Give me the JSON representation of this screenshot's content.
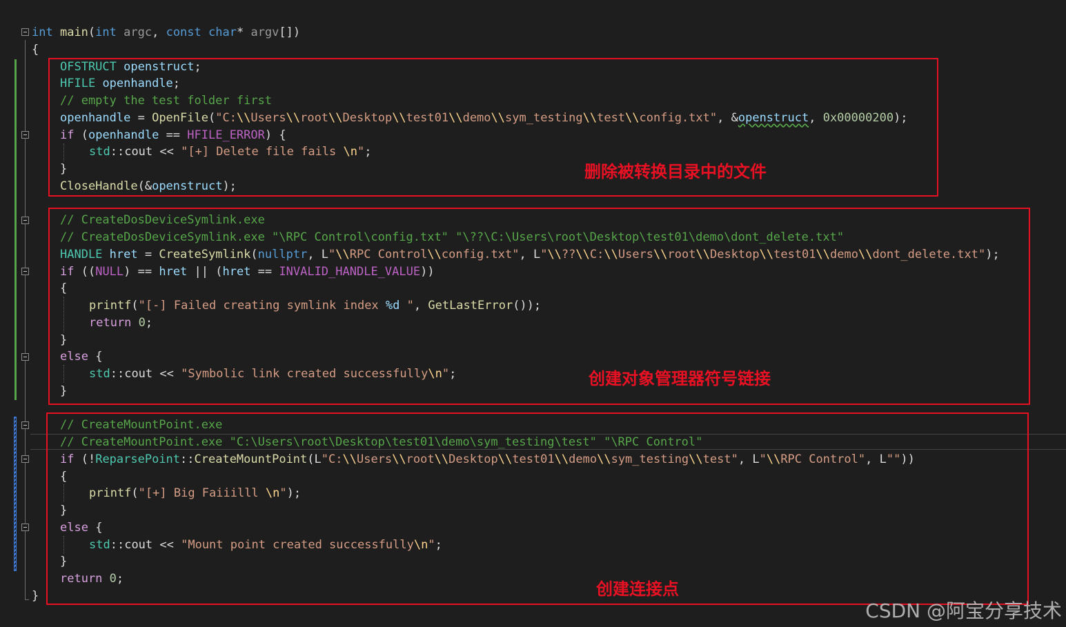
{
  "code_lines": [
    {
      "indent": 0,
      "tokens": [
        {
          "t": "int",
          "c": "#569cd6"
        },
        {
          "t": " "
        },
        {
          "t": "main",
          "c": "#dcdcaa"
        },
        {
          "t": "("
        },
        {
          "t": "int",
          "c": "#569cd6"
        },
        {
          "t": " "
        },
        {
          "t": "argc",
          "c": "#9a9a9a"
        },
        {
          "t": ", "
        },
        {
          "t": "const",
          "c": "#569cd6"
        },
        {
          "t": " "
        },
        {
          "t": "char",
          "c": "#569cd6"
        },
        {
          "t": "* "
        },
        {
          "t": "argv",
          "c": "#9a9a9a"
        },
        {
          "t": "[])"
        }
      ]
    },
    {
      "indent": 0,
      "tokens": [
        {
          "t": "{"
        }
      ]
    },
    {
      "indent": 1,
      "tokens": [
        {
          "t": "OFSTRUCT",
          "c": "#4ec9b0"
        },
        {
          "t": " "
        },
        {
          "t": "openstruct",
          "c": "#9cdcfe"
        },
        {
          "t": ";"
        }
      ]
    },
    {
      "indent": 1,
      "tokens": [
        {
          "t": "HFILE",
          "c": "#4ec9b0"
        },
        {
          "t": " "
        },
        {
          "t": "openhandle",
          "c": "#9cdcfe"
        },
        {
          "t": ";"
        }
      ]
    },
    {
      "indent": 1,
      "tokens": [
        {
          "t": "// empty the test folder first",
          "c": "#57a64a"
        }
      ]
    },
    {
      "indent": 1,
      "tokens": [
        {
          "t": "openhandle",
          "c": "#9cdcfe"
        },
        {
          "t": " = "
        },
        {
          "t": "OpenFile",
          "c": "#dcdcaa"
        },
        {
          "t": "("
        },
        {
          "t": "\"C:",
          "c": "#d69d85"
        },
        {
          "t": "\\\\",
          "c": "#ffd68f"
        },
        {
          "t": "Users",
          "c": "#d69d85"
        },
        {
          "t": "\\\\",
          "c": "#ffd68f"
        },
        {
          "t": "root",
          "c": "#d69d85"
        },
        {
          "t": "\\\\",
          "c": "#ffd68f"
        },
        {
          "t": "Desktop",
          "c": "#d69d85"
        },
        {
          "t": "\\\\",
          "c": "#ffd68f"
        },
        {
          "t": "test01",
          "c": "#d69d85"
        },
        {
          "t": "\\\\",
          "c": "#ffd68f"
        },
        {
          "t": "demo",
          "c": "#d69d85"
        },
        {
          "t": "\\\\",
          "c": "#ffd68f"
        },
        {
          "t": "sym_testing",
          "c": "#d69d85"
        },
        {
          "t": "\\\\",
          "c": "#ffd68f"
        },
        {
          "t": "test",
          "c": "#d69d85"
        },
        {
          "t": "\\\\",
          "c": "#ffd68f"
        },
        {
          "t": "config.txt\"",
          "c": "#d69d85"
        },
        {
          "t": ", "
        },
        {
          "t": "&"
        },
        {
          "t": "openstruct",
          "c": "#9cdcfe",
          "u": 1
        },
        {
          "t": ", "
        },
        {
          "t": "0x00000200",
          "c": "#b5cea8"
        },
        {
          "t": ");"
        }
      ]
    },
    {
      "indent": 1,
      "tokens": [
        {
          "t": "if",
          "c": "#d8a0df"
        },
        {
          "t": " ("
        },
        {
          "t": "openhandle",
          "c": "#9cdcfe"
        },
        {
          "t": " == "
        },
        {
          "t": "HFILE_ERROR",
          "c": "#bd63c5"
        },
        {
          "t": ") {"
        }
      ]
    },
    {
      "indent": 2,
      "tokens": [
        {
          "t": "std",
          "c": "#4ec9b0"
        },
        {
          "t": "::"
        },
        {
          "t": "cout",
          "c": "#dcdcdc"
        },
        {
          "t": " << "
        },
        {
          "t": "\"[+] Delete file fails ",
          "c": "#d69d85"
        },
        {
          "t": "\\n",
          "c": "#ffd68f"
        },
        {
          "t": "\"",
          "c": "#d69d85"
        },
        {
          "t": ";"
        }
      ]
    },
    {
      "indent": 1,
      "tokens": [
        {
          "t": "}"
        }
      ]
    },
    {
      "indent": 1,
      "tokens": [
        {
          "t": "CloseHandle",
          "c": "#dcdcaa"
        },
        {
          "t": "(&"
        },
        {
          "t": "openstruct",
          "c": "#9cdcfe"
        },
        {
          "t": ");"
        }
      ]
    },
    {
      "indent": 1,
      "tokens": []
    },
    {
      "indent": 1,
      "tokens": [
        {
          "t": "// CreateDosDeviceSymlink.exe",
          "c": "#57a64a"
        }
      ]
    },
    {
      "indent": 1,
      "tokens": [
        {
          "t": "// CreateDosDeviceSymlink.exe \"\\RPC Control\\config.txt\" \"\\??\\C:\\Users\\root\\Desktop\\test01\\demo\\dont_delete.txt\"",
          "c": "#57a64a"
        }
      ]
    },
    {
      "indent": 1,
      "tokens": [
        {
          "t": "HANDLE",
          "c": "#4ec9b0"
        },
        {
          "t": " "
        },
        {
          "t": "hret",
          "c": "#9cdcfe"
        },
        {
          "t": " = "
        },
        {
          "t": "CreateSymlink",
          "c": "#dcdcaa"
        },
        {
          "t": "("
        },
        {
          "t": "nullptr",
          "c": "#569cd6"
        },
        {
          "t": ", "
        },
        {
          "t": "L"
        },
        {
          "t": "\"",
          "c": "#d69d85"
        },
        {
          "t": "\\\\",
          "c": "#ffd68f"
        },
        {
          "t": "RPC Control",
          "c": "#d69d85"
        },
        {
          "t": "\\\\",
          "c": "#ffd68f"
        },
        {
          "t": "config.txt\"",
          "c": "#d69d85"
        },
        {
          "t": ", "
        },
        {
          "t": "L"
        },
        {
          "t": "\"",
          "c": "#d69d85"
        },
        {
          "t": "\\\\",
          "c": "#ffd68f"
        },
        {
          "t": "??",
          "c": "#d69d85"
        },
        {
          "t": "\\\\",
          "c": "#ffd68f"
        },
        {
          "t": "C:",
          "c": "#d69d85"
        },
        {
          "t": "\\\\",
          "c": "#ffd68f"
        },
        {
          "t": "Users",
          "c": "#d69d85"
        },
        {
          "t": "\\\\",
          "c": "#ffd68f"
        },
        {
          "t": "root",
          "c": "#d69d85"
        },
        {
          "t": "\\\\",
          "c": "#ffd68f"
        },
        {
          "t": "Desktop",
          "c": "#d69d85"
        },
        {
          "t": "\\\\",
          "c": "#ffd68f"
        },
        {
          "t": "test01",
          "c": "#d69d85"
        },
        {
          "t": "\\\\",
          "c": "#ffd68f"
        },
        {
          "t": "demo",
          "c": "#d69d85"
        },
        {
          "t": "\\\\",
          "c": "#ffd68f"
        },
        {
          "t": "dont_delete.txt\"",
          "c": "#d69d85"
        },
        {
          "t": ");"
        }
      ]
    },
    {
      "indent": 1,
      "tokens": [
        {
          "t": "if",
          "c": "#d8a0df"
        },
        {
          "t": " (("
        },
        {
          "t": "NULL",
          "c": "#bd63c5"
        },
        {
          "t": ") == "
        },
        {
          "t": "hret",
          "c": "#9cdcfe"
        },
        {
          "t": " || ("
        },
        {
          "t": "hret",
          "c": "#9cdcfe"
        },
        {
          "t": " == "
        },
        {
          "t": "INVALID_HANDLE_VALUE",
          "c": "#bd63c5"
        },
        {
          "t": "))"
        }
      ]
    },
    {
      "indent": 1,
      "tokens": [
        {
          "t": "{"
        }
      ]
    },
    {
      "indent": 2,
      "tokens": [
        {
          "t": "printf",
          "c": "#dcdcaa"
        },
        {
          "t": "("
        },
        {
          "t": "\"[-] Failed creating symlink index ",
          "c": "#d69d85"
        },
        {
          "t": "%d",
          "c": "#9cdcfe"
        },
        {
          "t": " \"",
          "c": "#d69d85"
        },
        {
          "t": ", "
        },
        {
          "t": "GetLastError",
          "c": "#dcdcaa"
        },
        {
          "t": "());"
        }
      ]
    },
    {
      "indent": 2,
      "tokens": [
        {
          "t": "return",
          "c": "#d8a0df"
        },
        {
          "t": " "
        },
        {
          "t": "0",
          "c": "#b5cea8"
        },
        {
          "t": ";"
        }
      ]
    },
    {
      "indent": 1,
      "tokens": [
        {
          "t": "}"
        }
      ]
    },
    {
      "indent": 1,
      "tokens": [
        {
          "t": "else",
          "c": "#d8a0df"
        },
        {
          "t": " {"
        }
      ]
    },
    {
      "indent": 2,
      "tokens": [
        {
          "t": "std",
          "c": "#4ec9b0"
        },
        {
          "t": "::"
        },
        {
          "t": "cout",
          "c": "#dcdcdc"
        },
        {
          "t": " << "
        },
        {
          "t": "\"Symbolic link created successfully",
          "c": "#d69d85"
        },
        {
          "t": "\\n",
          "c": "#ffd68f"
        },
        {
          "t": "\"",
          "c": "#d69d85"
        },
        {
          "t": ";"
        }
      ]
    },
    {
      "indent": 1,
      "tokens": [
        {
          "t": "}"
        }
      ]
    },
    {
      "indent": 1,
      "tokens": []
    },
    {
      "indent": 1,
      "tokens": [
        {
          "t": "// CreateMountPoint.exe",
          "c": "#57a64a"
        }
      ]
    },
    {
      "indent": 1,
      "tokens": [
        {
          "t": "// CreateMountPoint.exe \"C:\\Users\\root\\Desktop\\test01\\demo\\sym_testing\\test\" \"\\RPC Control\"",
          "c": "#57a64a"
        }
      ]
    },
    {
      "indent": 1,
      "tokens": [
        {
          "t": "if",
          "c": "#d8a0df"
        },
        {
          "t": " (!"
        },
        {
          "t": "ReparsePoint",
          "c": "#4ec9b0"
        },
        {
          "t": "::"
        },
        {
          "t": "CreateMountPoint",
          "c": "#dcdcaa"
        },
        {
          "t": "("
        },
        {
          "t": "L"
        },
        {
          "t": "\"C:",
          "c": "#d69d85"
        },
        {
          "t": "\\\\",
          "c": "#ffd68f"
        },
        {
          "t": "Users",
          "c": "#d69d85"
        },
        {
          "t": "\\\\",
          "c": "#ffd68f"
        },
        {
          "t": "root",
          "c": "#d69d85"
        },
        {
          "t": "\\\\",
          "c": "#ffd68f"
        },
        {
          "t": "Desktop",
          "c": "#d69d85"
        },
        {
          "t": "\\\\",
          "c": "#ffd68f"
        },
        {
          "t": "test01",
          "c": "#d69d85"
        },
        {
          "t": "\\\\",
          "c": "#ffd68f"
        },
        {
          "t": "demo",
          "c": "#d69d85"
        },
        {
          "t": "\\\\",
          "c": "#ffd68f"
        },
        {
          "t": "sym_testing",
          "c": "#d69d85"
        },
        {
          "t": "\\\\",
          "c": "#ffd68f"
        },
        {
          "t": "test\"",
          "c": "#d69d85"
        },
        {
          "t": ", "
        },
        {
          "t": "L"
        },
        {
          "t": "\"",
          "c": "#d69d85"
        },
        {
          "t": "\\\\",
          "c": "#ffd68f"
        },
        {
          "t": "RPC Control\"",
          "c": "#d69d85"
        },
        {
          "t": ", "
        },
        {
          "t": "L"
        },
        {
          "t": "\"\"",
          "c": "#d69d85"
        },
        {
          "t": "))"
        }
      ]
    },
    {
      "indent": 1,
      "tokens": [
        {
          "t": "{"
        }
      ]
    },
    {
      "indent": 2,
      "tokens": [
        {
          "t": "printf",
          "c": "#dcdcaa"
        },
        {
          "t": "("
        },
        {
          "t": "\"[+] Big Faiiilll ",
          "c": "#d69d85"
        },
        {
          "t": "\\n",
          "c": "#ffd68f"
        },
        {
          "t": "\"",
          "c": "#d69d85"
        },
        {
          "t": ");"
        }
      ]
    },
    {
      "indent": 1,
      "tokens": [
        {
          "t": "}"
        }
      ]
    },
    {
      "indent": 1,
      "tokens": [
        {
          "t": "else",
          "c": "#d8a0df"
        },
        {
          "t": " {"
        }
      ]
    },
    {
      "indent": 2,
      "tokens": [
        {
          "t": "std",
          "c": "#4ec9b0"
        },
        {
          "t": "::"
        },
        {
          "t": "cout",
          "c": "#dcdcdc"
        },
        {
          "t": " << "
        },
        {
          "t": "\"Mount point created successfully",
          "c": "#d69d85"
        },
        {
          "t": "\\n",
          "c": "#ffd68f"
        },
        {
          "t": "\"",
          "c": "#d69d85"
        },
        {
          "t": ";"
        }
      ]
    },
    {
      "indent": 1,
      "tokens": [
        {
          "t": "}"
        }
      ]
    },
    {
      "indent": 1,
      "tokens": [
        {
          "t": "return",
          "c": "#d8a0df"
        },
        {
          "t": " "
        },
        {
          "t": "0",
          "c": "#b5cea8"
        },
        {
          "t": ";"
        }
      ]
    },
    {
      "indent": 0,
      "tokens": [
        {
          "t": "}"
        }
      ]
    }
  ],
  "annotations": {
    "delete_files": "删除被转换目录中的文件",
    "create_symlink": "创建对象管理器符号链接",
    "create_mountpoint": "创建连接点"
  },
  "watermark": "CSDN @阿宝分享技术",
  "colors": {
    "background": "#1e1e1e",
    "annotation_red": "#e81123",
    "keyword": "#569cd6",
    "control": "#d8a0df",
    "type": "#4ec9b0",
    "function": "#dcdcaa",
    "variable": "#9cdcfe",
    "string": "#d69d85",
    "escape": "#ffd68f",
    "comment": "#57a64a",
    "number": "#b5cea8",
    "macro": "#bd63c5"
  }
}
